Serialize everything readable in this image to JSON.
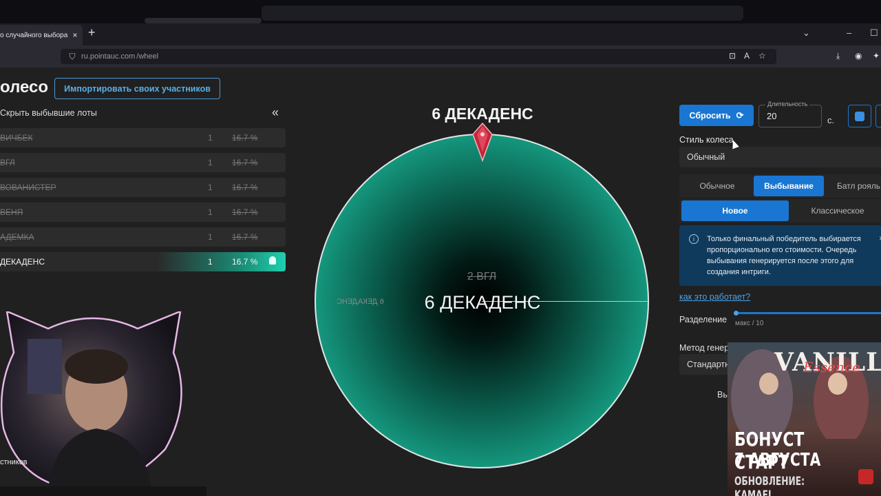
{
  "browser": {
    "tab_title": "о случайного выбора – P",
    "tab_close": "×",
    "new_tab": "+",
    "url_host": "ru.pointauc.com",
    "url_path": "/wheel"
  },
  "header": {
    "title": "олесо",
    "import_button": "Импортировать своих участников"
  },
  "lots_panel": {
    "hide_toggle": "Скрыть выбывшие лоты",
    "collapse_icon": "«",
    "lots": [
      {
        "name": "ВИЧБЕК",
        "amount": "1",
        "percent": "16.7 %",
        "eliminated": true
      },
      {
        "name": "ВГЛ",
        "amount": "1",
        "percent": "16.7 %",
        "eliminated": true
      },
      {
        "name": "ВОВАНИСТЕР",
        "amount": "1",
        "percent": "16.7 %",
        "eliminated": true
      },
      {
        "name": "ВЕНЯ",
        "amount": "1",
        "percent": "16.7 %",
        "eliminated": true
      },
      {
        "name": "АДЕМКА",
        "amount": "1",
        "percent": "16.7 %",
        "eliminated": true
      },
      {
        "name": "ДЕКАДЕНС",
        "amount": "1",
        "percent": "16.7 %",
        "eliminated": false
      }
    ]
  },
  "wheel": {
    "winner_top": "6 ДЕКАДЕНС",
    "center_label": "6 ДЕКАДЕНС",
    "ghost_label": "2 ВГЛ",
    "mirror_label": "6 ДЕКАДЕНС",
    "fill_color": "#1aa48a"
  },
  "controls": {
    "reset_button": "Сбросить",
    "duration_label": "Длительность",
    "duration_value": "20",
    "duration_unit": "с.",
    "style_label": "Стиль колеса",
    "style_value": "Обычный",
    "mode_tabs": [
      "Обычное",
      "Выбывание",
      "Батл рояль"
    ],
    "mode_selected": "Выбывание",
    "variant_tabs": [
      "Новое",
      "Классическое"
    ],
    "variant_selected": "Новое",
    "info_text": "Только финальный победитель выбирается пропорционально его стоимости. Очередь выбывания генерируется после этого для создания интриги.",
    "how_link": "как это работает?",
    "split_label": "Разделение",
    "split_hint": "макс / 10",
    "method_label": "Метод генер",
    "method_value": "Стандартн",
    "partial_text": "Вы"
  },
  "overlays": {
    "cam_label": "стников",
    "ad_logo": "VANILLA",
    "ad_logo_script": "Essence",
    "ad_line1": "БОНУСТ СТАРТ",
    "ad_line2": "7 АВГУСТА",
    "ad_line3": "ОБНОВЛЕНИЕ: KAMAEL"
  },
  "colors": {
    "accent": "#1976d2",
    "teal": "#1aa48a",
    "link": "#4aa3ea"
  }
}
